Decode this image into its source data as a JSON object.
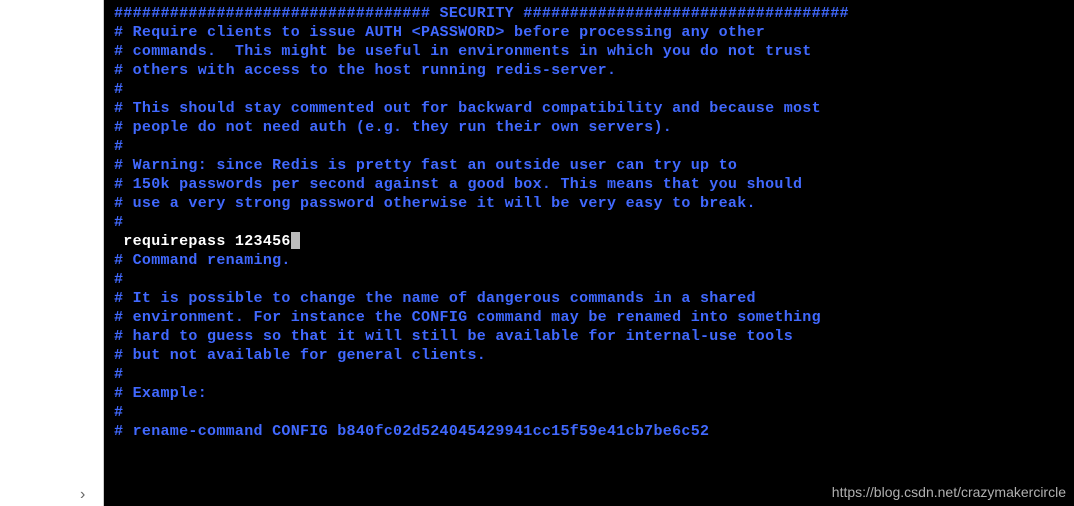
{
  "terminal": {
    "lines": [
      {
        "cls": "comment",
        "text": "################################## SECURITY ###################################"
      },
      {
        "cls": "comment",
        "text": ""
      },
      {
        "cls": "comment",
        "text": "# Require clients to issue AUTH <PASSWORD> before processing any other"
      },
      {
        "cls": "comment",
        "text": "# commands.  This might be useful in environments in which you do not trust"
      },
      {
        "cls": "comment",
        "text": "# others with access to the host running redis-server."
      },
      {
        "cls": "comment",
        "text": "#"
      },
      {
        "cls": "comment",
        "text": "# This should stay commented out for backward compatibility and because most"
      },
      {
        "cls": "comment",
        "text": "# people do not need auth (e.g. they run their own servers)."
      },
      {
        "cls": "comment",
        "text": "#"
      },
      {
        "cls": "comment",
        "text": "# Warning: since Redis is pretty fast an outside user can try up to"
      },
      {
        "cls": "comment",
        "text": "# 150k passwords per second against a good box. This means that you should"
      },
      {
        "cls": "comment",
        "text": "# use a very strong password otherwise it will be very easy to break."
      },
      {
        "cls": "comment",
        "text": "#"
      },
      {
        "cls": "active",
        "text": " requirepass 123456",
        "cursor": true
      },
      {
        "cls": "comment",
        "text": ""
      },
      {
        "cls": "comment",
        "text": "# Command renaming."
      },
      {
        "cls": "comment",
        "text": "#"
      },
      {
        "cls": "comment",
        "text": "# It is possible to change the name of dangerous commands in a shared"
      },
      {
        "cls": "comment",
        "text": "# environment. For instance the CONFIG command may be renamed into something"
      },
      {
        "cls": "comment",
        "text": "# hard to guess so that it will still be available for internal-use tools"
      },
      {
        "cls": "comment",
        "text": "# but not available for general clients."
      },
      {
        "cls": "comment",
        "text": "#"
      },
      {
        "cls": "comment",
        "text": "# Example:"
      },
      {
        "cls": "comment",
        "text": "#"
      },
      {
        "cls": "comment",
        "text": "# rename-command CONFIG b840fc02d524045429941cc15f59e41cb7be6c52"
      }
    ]
  },
  "watermark": "https://blog.csdn.net/crazymakercircle",
  "chevron": "›"
}
